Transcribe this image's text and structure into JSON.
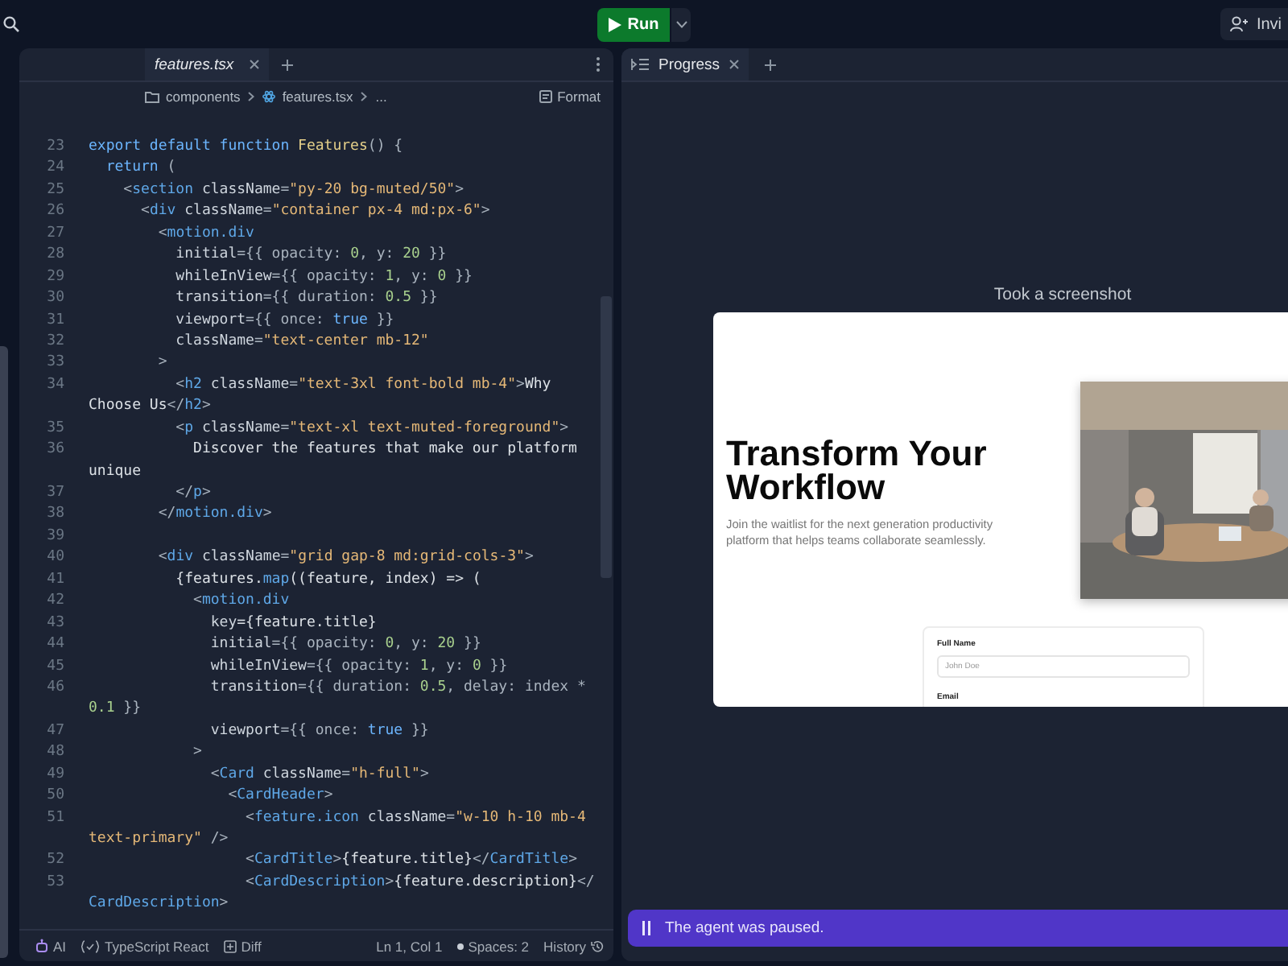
{
  "top_bar": {
    "run_button": "Run",
    "invite_button": "Invi"
  },
  "editor": {
    "tabs": [
      {
        "label": "features.tsx",
        "selected": true
      }
    ],
    "breadcrumb": [
      {
        "kind": "folder",
        "label": "components"
      },
      {
        "kind": "file",
        "label": "features.tsx"
      },
      {
        "kind": "text",
        "label": "..."
      }
    ],
    "format_button": "Format",
    "lines": [
      {
        "number": "23",
        "tokens": [
          {
            "text": "export default function ",
            "kind": "kw"
          },
          {
            "text": "Features",
            "kind": "fn"
          },
          {
            "text": "() {",
            "kind": "p"
          }
        ]
      },
      {
        "number": "24",
        "tokens": [
          {
            "text": "  return",
            "kind": "kw"
          },
          {
            "text": " (",
            "kind": "p"
          }
        ]
      },
      {
        "number": "25",
        "tokens": [
          {
            "text": "    <",
            "kind": "p"
          },
          {
            "text": "section",
            "kind": "tag"
          },
          {
            "text": " className",
            "kind": "attr"
          },
          {
            "text": "=",
            "kind": "p"
          },
          {
            "text": "\"py-20 bg-muted/50\"",
            "kind": "str"
          },
          {
            "text": ">",
            "kind": "p"
          }
        ]
      },
      {
        "number": "26",
        "tokens": [
          {
            "text": "      <",
            "kind": "p"
          },
          {
            "text": "div",
            "kind": "tag"
          },
          {
            "text": " className",
            "kind": "attr"
          },
          {
            "text": "=",
            "kind": "p"
          },
          {
            "text": "\"container px-4 md:px-6\"",
            "kind": "str"
          },
          {
            "text": ">",
            "kind": "p"
          }
        ]
      },
      {
        "number": "27",
        "tokens": [
          {
            "text": "        <",
            "kind": "p"
          },
          {
            "text": "motion.div",
            "kind": "tag"
          }
        ]
      },
      {
        "number": "28",
        "tokens": [
          {
            "text": "          initial",
            "kind": "attr"
          },
          {
            "text": "={{ opacity: ",
            "kind": "p"
          },
          {
            "text": "0",
            "kind": "num"
          },
          {
            "text": ", y: ",
            "kind": "p"
          },
          {
            "text": "20",
            "kind": "num"
          },
          {
            "text": " }}",
            "kind": "p"
          }
        ]
      },
      {
        "number": "29",
        "tokens": [
          {
            "text": "          whileInView",
            "kind": "attr"
          },
          {
            "text": "={{ opacity: ",
            "kind": "p"
          },
          {
            "text": "1",
            "kind": "num"
          },
          {
            "text": ", y: ",
            "kind": "p"
          },
          {
            "text": "0",
            "kind": "num"
          },
          {
            "text": " }}",
            "kind": "p"
          }
        ]
      },
      {
        "number": "30",
        "tokens": [
          {
            "text": "          transition",
            "kind": "attr"
          },
          {
            "text": "={{ duration: ",
            "kind": "p"
          },
          {
            "text": "0.5",
            "kind": "num"
          },
          {
            "text": " }}",
            "kind": "p"
          }
        ]
      },
      {
        "number": "31",
        "tokens": [
          {
            "text": "          viewport",
            "kind": "attr"
          },
          {
            "text": "={{ once: ",
            "kind": "p"
          },
          {
            "text": "true",
            "kind": "kw"
          },
          {
            "text": " }}",
            "kind": "p"
          }
        ]
      },
      {
        "number": "32",
        "tokens": [
          {
            "text": "          className",
            "kind": "attr"
          },
          {
            "text": "=",
            "kind": "p"
          },
          {
            "text": "\"text-center mb-12\"",
            "kind": "str"
          }
        ]
      },
      {
        "number": "33",
        "tokens": [
          {
            "text": "        >",
            "kind": "p"
          }
        ]
      },
      {
        "number": "34",
        "tokens": [
          {
            "text": "          <",
            "kind": "p"
          },
          {
            "text": "h2",
            "kind": "tag"
          },
          {
            "text": " className",
            "kind": "attr"
          },
          {
            "text": "=",
            "kind": "p"
          },
          {
            "text": "\"text-3xl font-bold mb-4\"",
            "kind": "str"
          },
          {
            "text": ">",
            "kind": "p"
          },
          {
            "text": "Why",
            "kind": "t"
          }
        ]
      },
      {
        "tokens": [
          {
            "text": "Choose Us",
            "kind": "t"
          },
          {
            "text": "</",
            "kind": "p"
          },
          {
            "text": "h2",
            "kind": "tag"
          },
          {
            "text": ">",
            "kind": "p"
          }
        ]
      },
      {
        "number": "35",
        "tokens": [
          {
            "text": "          <",
            "kind": "p"
          },
          {
            "text": "p",
            "kind": "tag"
          },
          {
            "text": " className",
            "kind": "attr"
          },
          {
            "text": "=",
            "kind": "p"
          },
          {
            "text": "\"text-xl text-muted-foreground\"",
            "kind": "str"
          },
          {
            "text": ">",
            "kind": "p"
          }
        ]
      },
      {
        "number": "36",
        "tokens": [
          {
            "text": "            Discover the features that make our platform",
            "kind": "t"
          }
        ]
      },
      {
        "tokens": [
          {
            "text": "unique",
            "kind": "t"
          }
        ]
      },
      {
        "number": "37",
        "tokens": [
          {
            "text": "          </",
            "kind": "p"
          },
          {
            "text": "p",
            "kind": "tag"
          },
          {
            "text": ">",
            "kind": "p"
          }
        ]
      },
      {
        "number": "38",
        "tokens": [
          {
            "text": "        </",
            "kind": "p"
          },
          {
            "text": "motion.div",
            "kind": "tag"
          },
          {
            "text": ">",
            "kind": "p"
          }
        ]
      },
      {
        "number": "39"
      },
      {
        "number": "40",
        "tokens": [
          {
            "text": "        <",
            "kind": "p"
          },
          {
            "text": "div",
            "kind": "tag"
          },
          {
            "text": " className",
            "kind": "attr"
          },
          {
            "text": "=",
            "kind": "p"
          },
          {
            "text": "\"grid gap-8 md:grid-cols-3\"",
            "kind": "str"
          },
          {
            "text": ">",
            "kind": "p"
          }
        ]
      },
      {
        "number": "41",
        "tokens": [
          {
            "text": "          {features.",
            "kind": "t"
          },
          {
            "text": "map",
            "kind": "tag"
          },
          {
            "text": "((feature, index) => (",
            "kind": "t"
          }
        ]
      },
      {
        "number": "42",
        "tokens": [
          {
            "text": "            <",
            "kind": "p"
          },
          {
            "text": "motion.div",
            "kind": "tag"
          }
        ]
      },
      {
        "number": "43",
        "tokens": [
          {
            "text": "              key",
            "kind": "attr"
          },
          {
            "text": "={feature.title}",
            "kind": "t"
          }
        ]
      },
      {
        "number": "44",
        "tokens": [
          {
            "text": "              initial",
            "kind": "attr"
          },
          {
            "text": "={{ opacity: ",
            "kind": "p"
          },
          {
            "text": "0",
            "kind": "num"
          },
          {
            "text": ", y: ",
            "kind": "p"
          },
          {
            "text": "20",
            "kind": "num"
          },
          {
            "text": " }}",
            "kind": "p"
          }
        ]
      },
      {
        "number": "45",
        "tokens": [
          {
            "text": "              whileInView",
            "kind": "attr"
          },
          {
            "text": "={{ opacity: ",
            "kind": "p"
          },
          {
            "text": "1",
            "kind": "num"
          },
          {
            "text": ", y: ",
            "kind": "p"
          },
          {
            "text": "0",
            "kind": "num"
          },
          {
            "text": " }}",
            "kind": "p"
          }
        ]
      },
      {
        "number": "46",
        "tokens": [
          {
            "text": "              transition",
            "kind": "attr"
          },
          {
            "text": "={{ duration: ",
            "kind": "p"
          },
          {
            "text": "0.5",
            "kind": "num"
          },
          {
            "text": ", delay: index *",
            "kind": "p"
          }
        ]
      },
      {
        "tokens": [
          {
            "text": "0.1",
            "kind": "num"
          },
          {
            "text": " }}",
            "kind": "p"
          }
        ]
      },
      {
        "number": "47",
        "tokens": [
          {
            "text": "              viewport",
            "kind": "attr"
          },
          {
            "text": "={{ once: ",
            "kind": "p"
          },
          {
            "text": "true",
            "kind": "kw"
          },
          {
            "text": " }}",
            "kind": "p"
          }
        ]
      },
      {
        "number": "48",
        "tokens": [
          {
            "text": "            >",
            "kind": "p"
          }
        ]
      },
      {
        "number": "49",
        "tokens": [
          {
            "text": "              <",
            "kind": "p"
          },
          {
            "text": "Card",
            "kind": "tag"
          },
          {
            "text": " className",
            "kind": "attr"
          },
          {
            "text": "=",
            "kind": "p"
          },
          {
            "text": "\"h-full\"",
            "kind": "str"
          },
          {
            "text": ">",
            "kind": "p"
          }
        ]
      },
      {
        "number": "50",
        "tokens": [
          {
            "text": "                <",
            "kind": "p"
          },
          {
            "text": "CardHeader",
            "kind": "tag"
          },
          {
            "text": ">",
            "kind": "p"
          }
        ]
      },
      {
        "number": "51",
        "tokens": [
          {
            "text": "                  <",
            "kind": "p"
          },
          {
            "text": "feature.icon",
            "kind": "tag"
          },
          {
            "text": " className",
            "kind": "attr"
          },
          {
            "text": "=",
            "kind": "p"
          },
          {
            "text": "\"w-10 h-10 mb-4",
            "kind": "str"
          }
        ]
      },
      {
        "tokens": [
          {
            "text": "text-primary\"",
            "kind": "str"
          },
          {
            "text": " />",
            "kind": "p"
          }
        ]
      },
      {
        "number": "52",
        "tokens": [
          {
            "text": "                  <",
            "kind": "p"
          },
          {
            "text": "CardTitle",
            "kind": "tag"
          },
          {
            "text": ">",
            "kind": "p"
          },
          {
            "text": "{feature.title}",
            "kind": "t"
          },
          {
            "text": "</",
            "kind": "p"
          },
          {
            "text": "CardTitle",
            "kind": "tag"
          },
          {
            "text": ">",
            "kind": "p"
          }
        ]
      },
      {
        "number": "53",
        "tokens": [
          {
            "text": "                  <",
            "kind": "p"
          },
          {
            "text": "CardDescription",
            "kind": "tag"
          },
          {
            "text": ">",
            "kind": "p"
          },
          {
            "text": "{feature.description}",
            "kind": "t"
          },
          {
            "text": "</",
            "kind": "p"
          }
        ]
      },
      {
        "tokens": [
          {
            "text": "CardDescription",
            "kind": "tag"
          },
          {
            "text": ">",
            "kind": "p"
          }
        ]
      }
    ]
  },
  "status_bar": {
    "items": [
      {
        "kind": "ai",
        "label": "AI"
      },
      {
        "kind": "language",
        "label": "TypeScript React"
      },
      {
        "kind": "diff",
        "label": "Diff"
      }
    ],
    "position": "Ln 1, Col 1",
    "spaces": "Spaces: 2",
    "history": "History"
  },
  "progress_panel": {
    "tabs": [
      {
        "label": "Progress",
        "selected": true
      }
    ],
    "event": "Took a screenshot",
    "screenshot": {
      "heading": "Transform Your Workflow",
      "subtitle": "Join the waitlist for the next generation productivity platform that helps teams collaborate seamlessly.",
      "form": [
        {
          "label": "Full Name",
          "placeholder": "John Doe"
        },
        {
          "label": "Email"
        }
      ]
    },
    "agent_status": "The agent was paused."
  }
}
